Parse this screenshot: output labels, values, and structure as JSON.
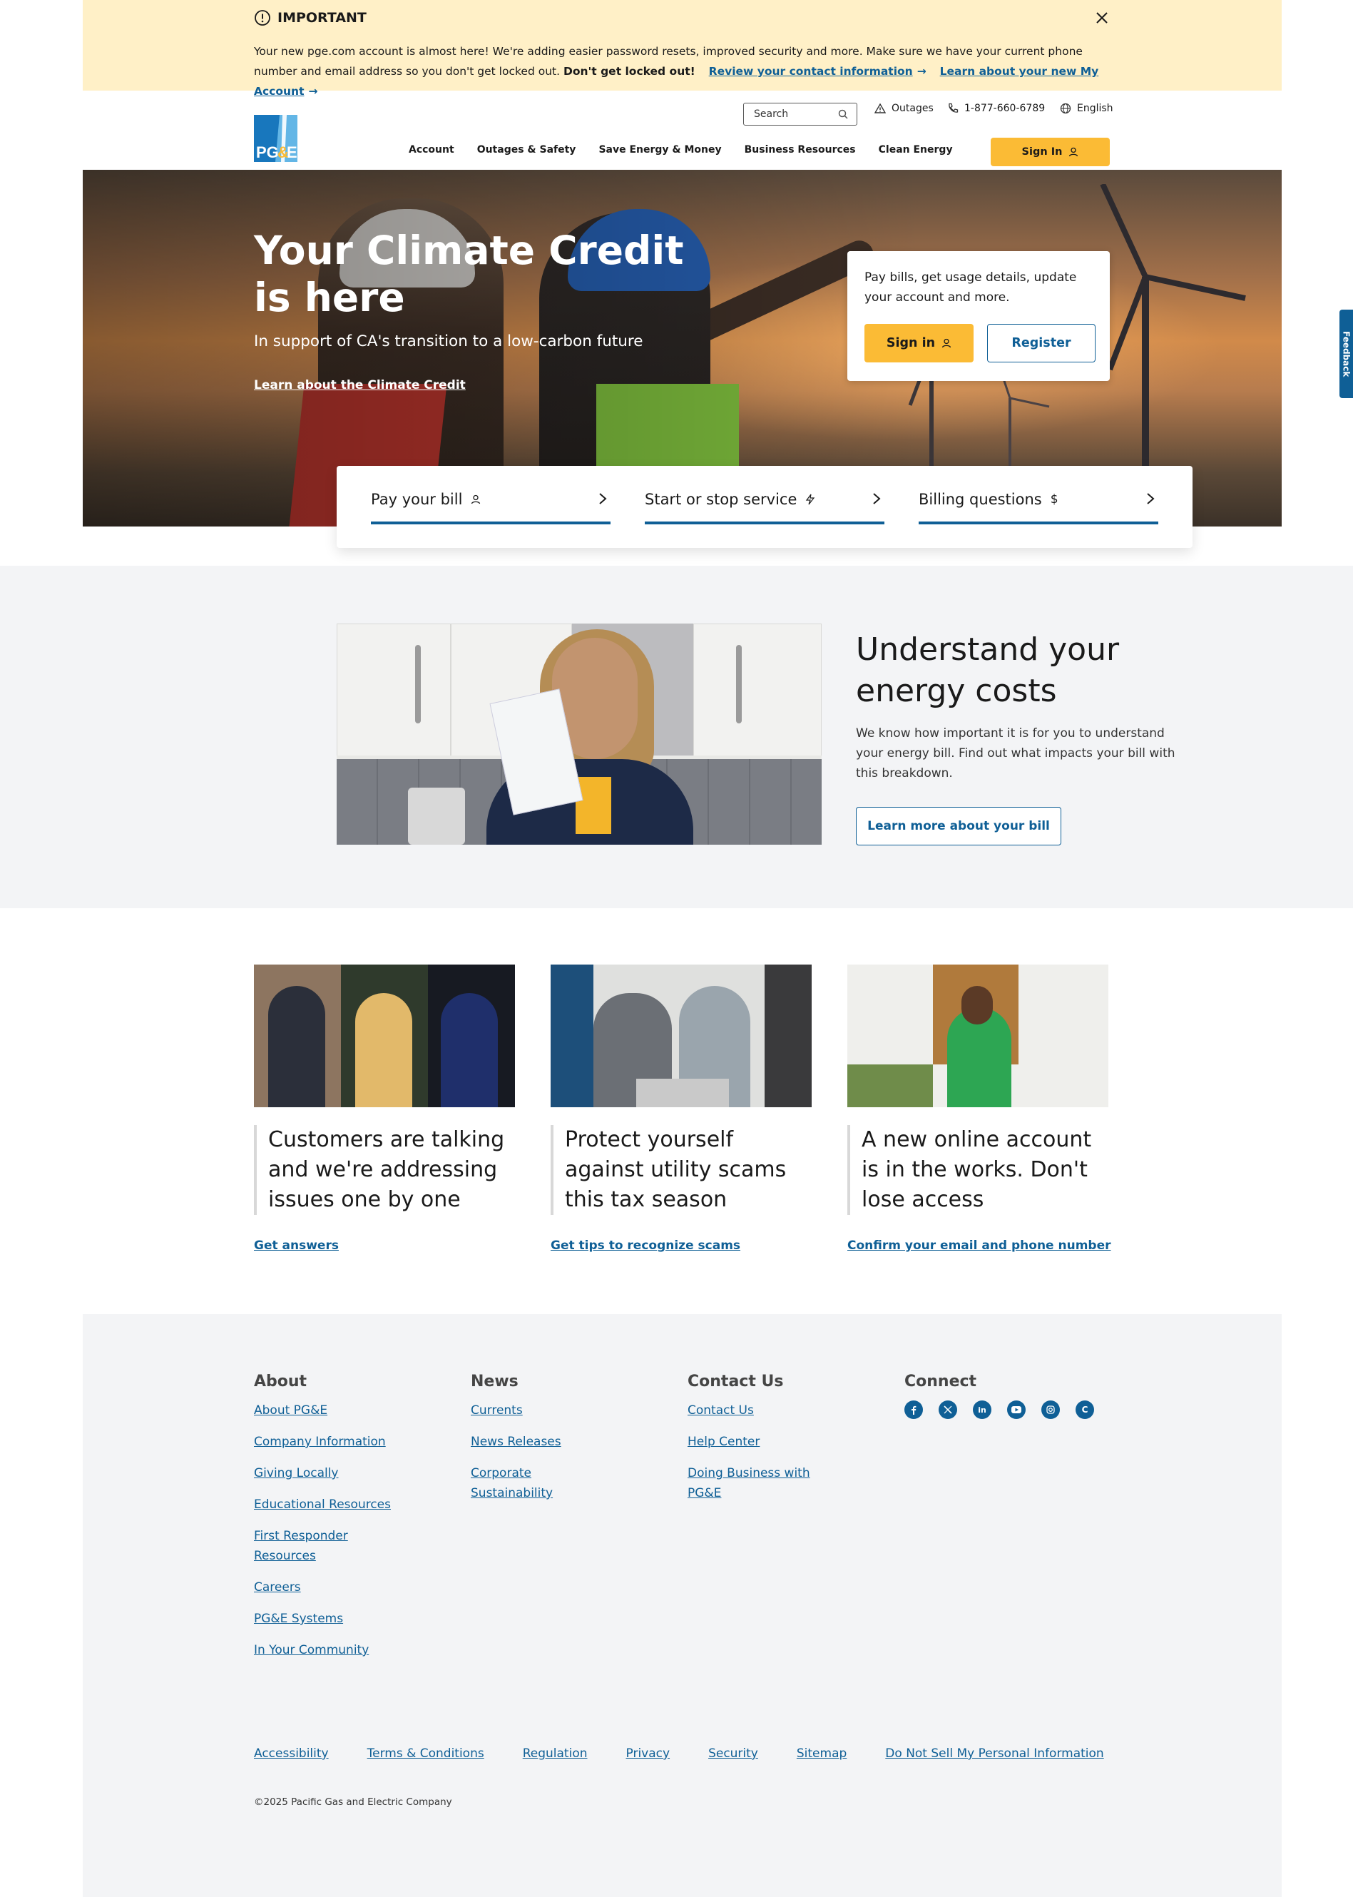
{
  "alert": {
    "title": "IMPORTANT",
    "text": "Your new pge.com account is almost here! We're adding easier password resets, improved security and more. Make sure we have your current phone number and email address so you don't get locked out.",
    "bold": "Don't get locked out!",
    "link1": "Review your contact information",
    "link2": "Learn about your new My Account"
  },
  "header": {
    "logo_text": "PG&E",
    "search_placeholder": "Search",
    "outages": "Outages",
    "phone": "1-877-660-6789",
    "language": "English",
    "nav": [
      "Account",
      "Outages & Safety",
      "Save Energy & Money",
      "Business Resources",
      "Clean Energy"
    ],
    "signin": "Sign In"
  },
  "hero": {
    "title": "Your Climate Credit is here",
    "subtitle": "In support of CA's transition to a low-carbon future",
    "link": "Learn about the Climate Credit",
    "card_text": "Pay bills, get usage details, update your account and more.",
    "signin": "Sign in",
    "register": "Register"
  },
  "quicklinks": [
    {
      "label": "Pay your bill",
      "icon": "user-icon"
    },
    {
      "label": "Start or stop service",
      "icon": "bolt-icon"
    },
    {
      "label": "Billing questions",
      "icon": "dollar-icon"
    }
  ],
  "video_section": {
    "title": "Understand your energy costs",
    "text": "We know how important it is for you to understand your energy bill. Find out what impacts your bill with this breakdown.",
    "button": "Learn more about your bill"
  },
  "cards": [
    {
      "headline": "Customers are talking and we're addressing issues one by one",
      "link": "Get answers"
    },
    {
      "headline": "Protect yourself against utility scams this tax season",
      "link": "Get tips to recognize scams"
    },
    {
      "headline": "A new online account is in the works. Don't lose access",
      "link": "Confirm your email and phone number"
    }
  ],
  "footer": {
    "about": {
      "heading": "About",
      "links": [
        "About PG&E",
        "Company Information",
        "Giving Locally",
        "Educational Resources",
        "First Responder Resources",
        "Careers",
        "PG&E Systems",
        "In Your Community"
      ]
    },
    "news": {
      "heading": "News",
      "links": [
        "Currents",
        "News Releases",
        "Corporate Sustainability"
      ]
    },
    "contact": {
      "heading": "Contact Us",
      "links": [
        "Contact Us",
        "Help Center",
        "Doing Business with PG&E"
      ]
    },
    "connect": {
      "heading": "Connect",
      "icons": [
        "facebook-icon",
        "x-icon",
        "linkedin-icon",
        "youtube-icon",
        "instagram-icon",
        "currents-icon"
      ]
    },
    "legal": [
      "Accessibility",
      "Terms & Conditions",
      "Regulation",
      "Privacy",
      "Security",
      "Sitemap",
      "Do Not Sell My Personal Information"
    ],
    "copyright": "©2025 Pacific Gas and Electric Company"
  },
  "feedback": "Feedback",
  "colors": {
    "brand_blue": "#0f5f96",
    "accent_yellow": "#fbbb35",
    "alert_bg": "#fff0c7",
    "section_gray": "#f3f4f6"
  }
}
